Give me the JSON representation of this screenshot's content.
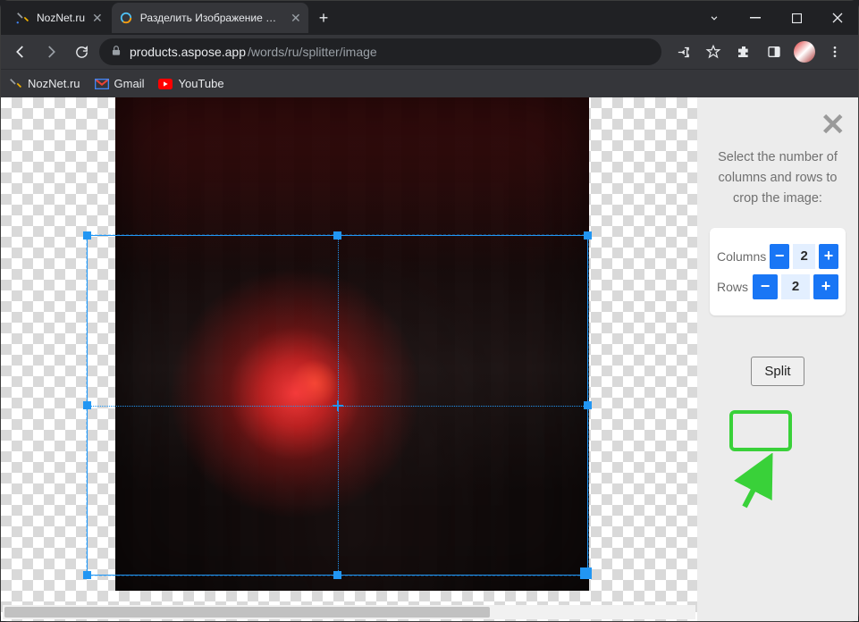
{
  "browser": {
    "tabs": [
      {
        "label": "NozNet.ru",
        "active": false
      },
      {
        "label": "Разделить Изображение На Час",
        "active": true
      }
    ],
    "url_host": "products.aspose.app",
    "url_path": "/words/ru/splitter/image",
    "bookmarks": [
      {
        "label": "NozNet.ru"
      },
      {
        "label": "Gmail"
      },
      {
        "label": "YouTube"
      }
    ]
  },
  "panel": {
    "instructions": "Select the number of columns and rows to crop the image:",
    "columns_label": "Columns",
    "columns_value": "2",
    "rows_label": "Rows",
    "rows_value": "2",
    "minus": "−",
    "plus": "+",
    "split_label": "Split"
  }
}
